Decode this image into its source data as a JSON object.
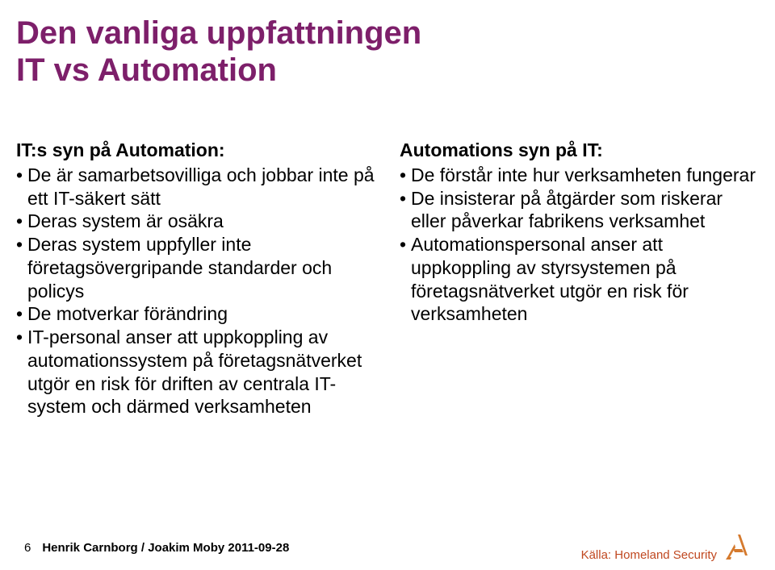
{
  "title": {
    "line1": "Den vanliga uppfattningen",
    "line2": "IT vs Automation"
  },
  "left": {
    "heading": "IT:s syn på Automation:",
    "bullets": [
      "De är samarbetsovilliga och jobbar inte på ett IT-säkert sätt",
      "Deras system är osäkra",
      "Deras system uppfyller inte företagsövergripande standarder och policys",
      "De motverkar förändring",
      "IT-personal anser att uppkoppling av automationssystem på företagsnätverket utgör en risk för driften av centrala IT-system och därmed verksamheten"
    ]
  },
  "right": {
    "heading": "Automations syn på IT:",
    "bullets": [
      "De förstår inte hur verksamheten fungerar",
      "De insisterar på åtgärder som riskerar eller påverkar fabrikens verksamhet",
      "Automationspersonal anser att uppkoppling av styrsystemen på företagsnätverket utgör en risk för verksamheten"
    ]
  },
  "footer": {
    "page": "6",
    "presenter": "Henrik Carnborg / Joakim Moby 2011-09-28",
    "source": "Källa: Homeland Security"
  },
  "colors": {
    "title": "#7d1f6a",
    "source": "#c04820",
    "logo": "#d57a2e"
  }
}
